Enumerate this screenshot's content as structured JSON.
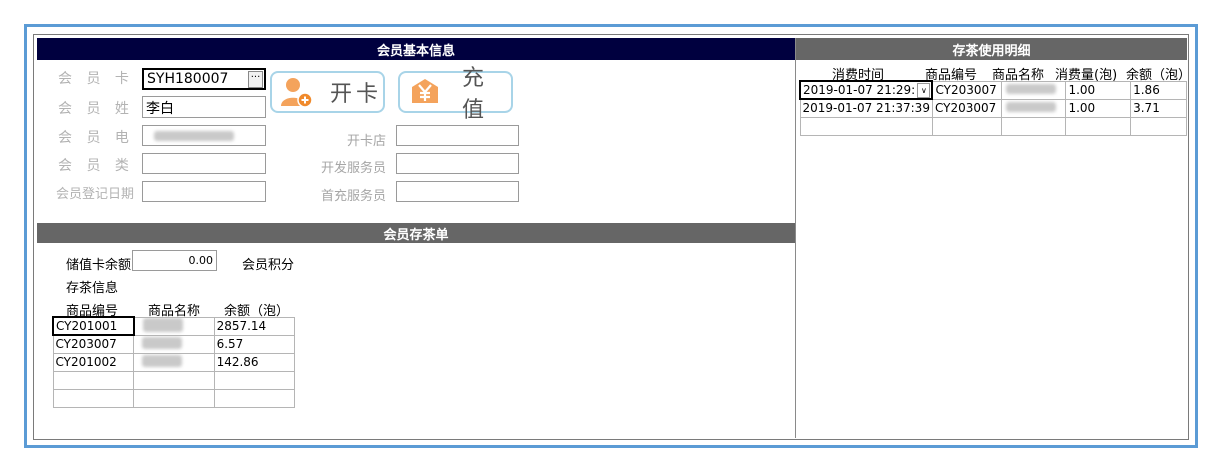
{
  "member_info": {
    "header": "会员基本信息",
    "card_no_label": "会 员 卡 号",
    "card_no_value": "SYH180007",
    "ellipsis": "···",
    "name_label": "会 员 姓 名",
    "name_value": "李白",
    "phone_label": "会 员 电 话",
    "type_label": "会 员 类 别",
    "reg_date_label": "会员登记日期",
    "open_store_label": "开卡店",
    "dev_staff_label": "开发服务员",
    "first_charge_label": "首充服务员",
    "open_card_button": "开卡",
    "recharge_button": "充值"
  },
  "tea_storage": {
    "header": "会员存茶单",
    "balance_label": "储值卡余额",
    "balance_value": "0.00",
    "points_label": "会员积分",
    "storage_info_label": "存茶信息",
    "columns": [
      "商品编号",
      "商品名称",
      "余额（泡）"
    ],
    "rows": [
      {
        "code": "CY201001",
        "name": "",
        "balance": "2857.14"
      },
      {
        "code": "CY203007",
        "name": "",
        "balance": "6.57"
      },
      {
        "code": "CY201002",
        "name": "",
        "balance": "142.86"
      },
      {
        "code": "",
        "name": "",
        "balance": ""
      },
      {
        "code": "",
        "name": "",
        "balance": ""
      }
    ]
  },
  "usage_detail": {
    "header": "存茶使用明细",
    "columns": [
      "消费时间",
      "商品编号",
      "商品名称",
      "消费量(泡)",
      "余额（泡）"
    ],
    "rows": [
      {
        "time": "2019-01-07 21:29:",
        "code": "CY203007",
        "name": "",
        "qty": "1.00",
        "balance": "1.86"
      },
      {
        "time": "2019-01-07 21:37:39",
        "code": "CY203007",
        "name": "",
        "qty": "1.00",
        "balance": "3.71"
      },
      {
        "time": "",
        "code": "",
        "name": "",
        "qty": "",
        "balance": ""
      }
    ]
  },
  "colors": {
    "header_dark": "#00003f",
    "header_gray": "#666666",
    "frame_blue": "#5b9bd5",
    "button_border": "#a8d4e8",
    "icon_orange": "#f4a35c"
  }
}
